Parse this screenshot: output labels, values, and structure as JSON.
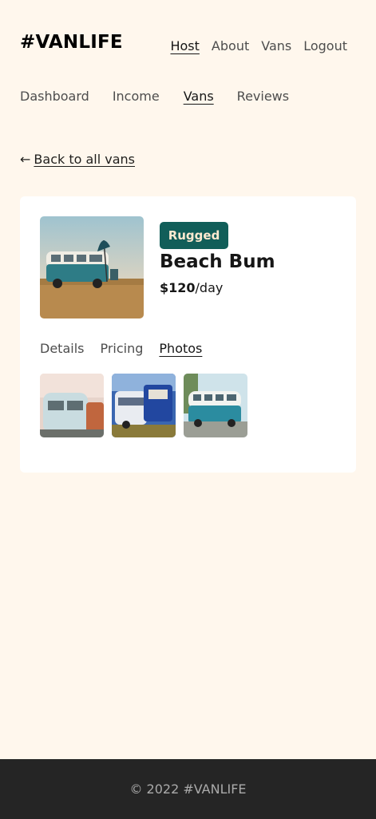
{
  "header": {
    "logo": "#VANLIFE",
    "nav": [
      "Host",
      "About",
      "Vans",
      "Logout"
    ]
  },
  "host_nav": [
    "Dashboard",
    "Income",
    "Vans",
    "Reviews"
  ],
  "back_link": {
    "arrow": "←",
    "label": "Back to all vans"
  },
  "van": {
    "type": "Rugged",
    "name": "Beach Bum",
    "price": "$120",
    "price_unit": "/day",
    "image_icon": "van-photo",
    "tabs": [
      "Details",
      "Pricing",
      "Photos"
    ],
    "active_tab": "Photos",
    "photos": [
      "van-photo-1",
      "van-photo-2",
      "van-photo-3"
    ]
  },
  "footer": {
    "text": "© 2022 #VANLIFE"
  },
  "colors": {
    "background": "#FFF7ED",
    "badge": "#115E59",
    "footer": "#252525"
  }
}
